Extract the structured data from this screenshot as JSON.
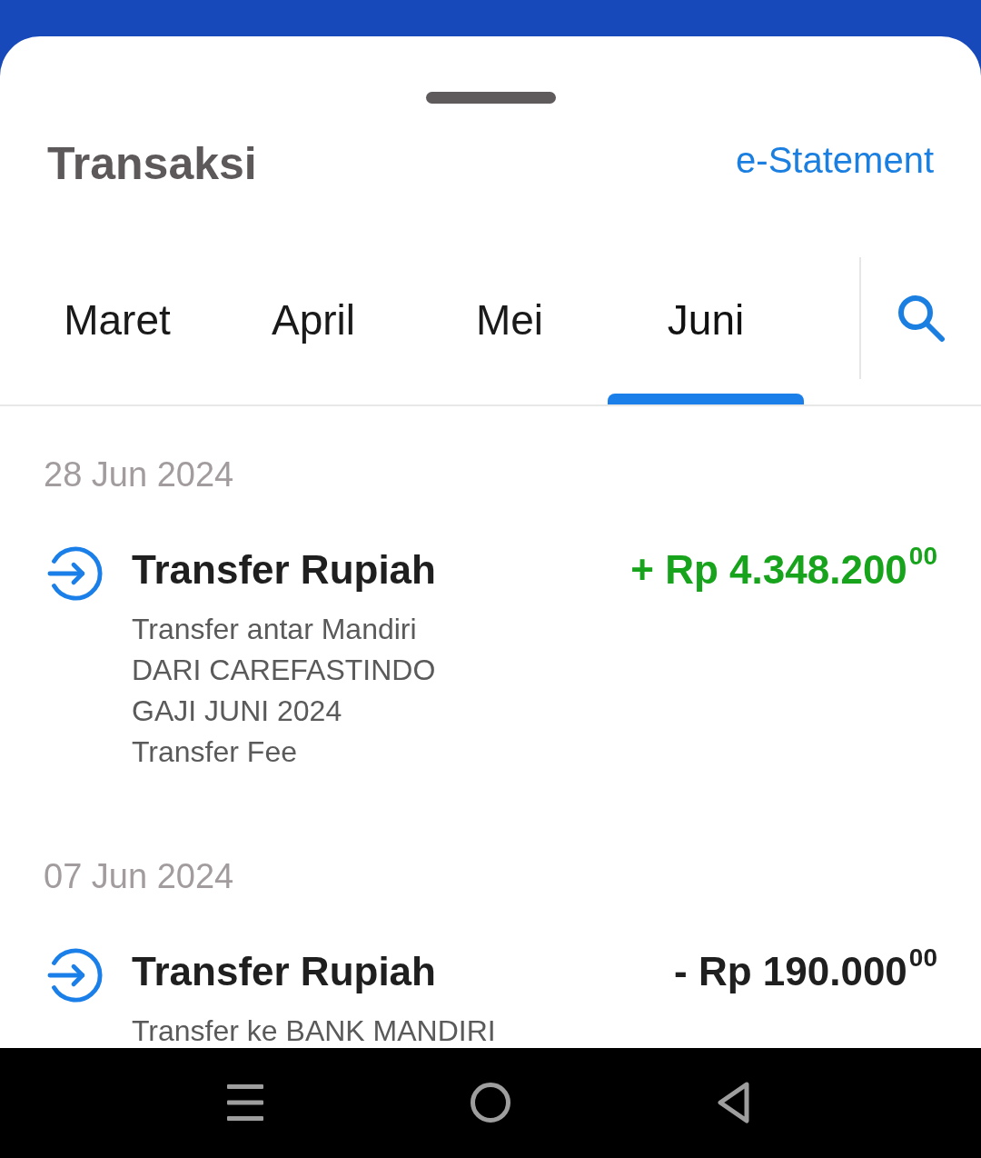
{
  "sheet": {
    "title": "Transaksi",
    "link": "e-Statement"
  },
  "tabs": [
    {
      "label": "Maret",
      "selected": false
    },
    {
      "label": "April",
      "selected": false
    },
    {
      "label": "Mei",
      "selected": false
    },
    {
      "label": "Juni",
      "selected": true
    }
  ],
  "transaction_groups": [
    {
      "date": "28 Jun 2024",
      "items": [
        {
          "title": "Transfer Rupiah",
          "kind": "credit",
          "amount": "+ Rp 4.348.200$^{00}$",
          "description_lines": [
            "Transfer antar Mandiri",
            "DARI CAREFASTINDO",
            "GAJI JUNI 2024",
            "Transfer Fee"
          ]
        }
      ]
    },
    {
      "date": "07 Jun 2024",
      "items": [
        {
          "title": "Transfer Rupiah",
          "kind": "debit",
          "amount": "- Rp 190.000$^{00}$",
          "description_lines": [
            "Transfer ke BANK MANDIRI"
          ]
        }
      ]
    }
  ]
}
